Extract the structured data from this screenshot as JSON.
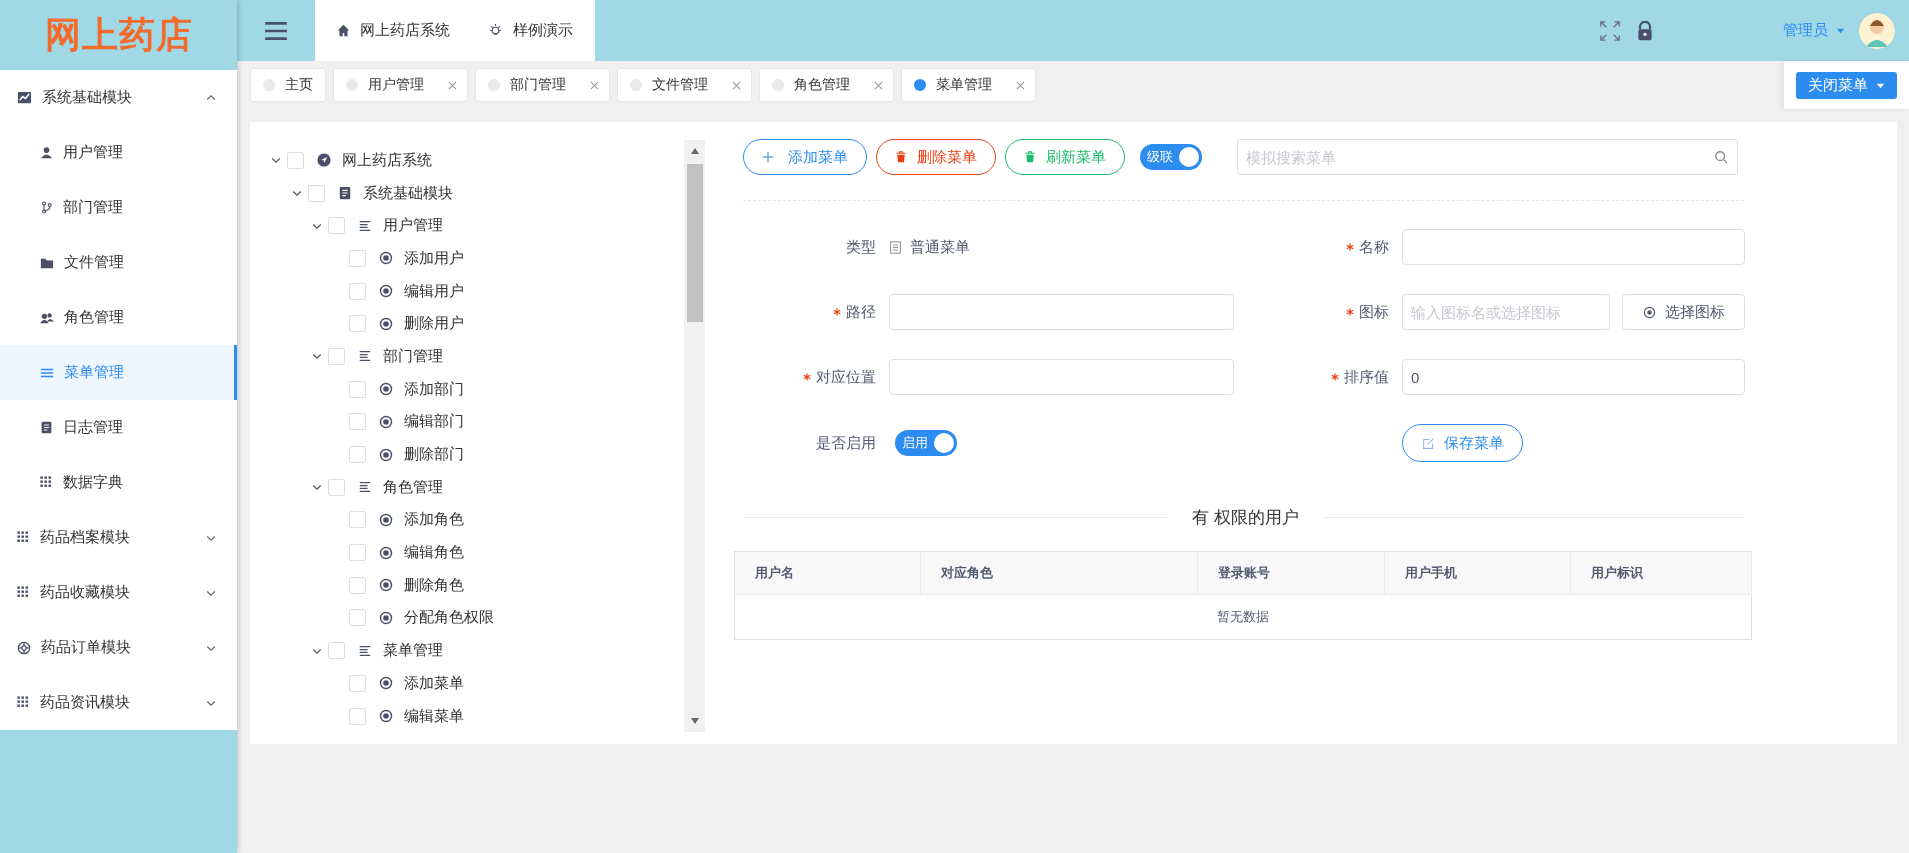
{
  "logo": "网上药店",
  "header": {
    "nav": [
      {
        "label": "网上药店系统"
      },
      {
        "label": "样例演示"
      }
    ],
    "user": "管理员"
  },
  "tabs": [
    {
      "label": "主页",
      "selected": false,
      "closable": false
    },
    {
      "label": "用户管理",
      "selected": false,
      "closable": true
    },
    {
      "label": "部门管理",
      "selected": false,
      "closable": true
    },
    {
      "label": "文件管理",
      "selected": false,
      "closable": true
    },
    {
      "label": "角色管理",
      "selected": false,
      "closable": true
    },
    {
      "label": "菜单管理",
      "selected": true,
      "closable": true
    }
  ],
  "close_menu": "关闭菜单",
  "sidebar": {
    "items": [
      {
        "label": "系统基础模块",
        "selected": false,
        "expanded": true,
        "children": [
          {
            "label": "用户管理",
            "selected": false
          },
          {
            "label": "部门管理",
            "selected": false
          },
          {
            "label": "文件管理",
            "selected": false
          },
          {
            "label": "角色管理",
            "selected": false
          },
          {
            "label": "菜单管理",
            "selected": true
          },
          {
            "label": "日志管理",
            "selected": false
          },
          {
            "label": "数据字典",
            "selected": false
          }
        ]
      },
      {
        "label": "药品档案模块",
        "selected": false,
        "expanded": false
      },
      {
        "label": "药品收藏模块",
        "selected": false,
        "expanded": false
      },
      {
        "label": "药品订单模块",
        "selected": false,
        "expanded": false
      },
      {
        "label": "药品资讯模块",
        "selected": false,
        "expanded": false
      }
    ]
  },
  "tree": [
    {
      "label": "网上药店系统",
      "kind": "system",
      "checked": false,
      "expanded": true,
      "children": [
        {
          "label": "系统基础模块",
          "kind": "module",
          "checked": false,
          "expanded": true,
          "children": [
            {
              "label": "用户管理",
              "kind": "menu",
              "checked": false,
              "expanded": true,
              "children": [
                {
                  "label": "添加用户",
                  "kind": "action",
                  "checked": false
                },
                {
                  "label": "编辑用户",
                  "kind": "action",
                  "checked": false
                },
                {
                  "label": "删除用户",
                  "kind": "action",
                  "checked": false
                }
              ]
            },
            {
              "label": "部门管理",
              "kind": "menu",
              "checked": false,
              "expanded": true,
              "children": [
                {
                  "label": "添加部门",
                  "kind": "action",
                  "checked": false
                },
                {
                  "label": "编辑部门",
                  "kind": "action",
                  "checked": false
                },
                {
                  "label": "删除部门",
                  "kind": "action",
                  "checked": false
                }
              ]
            },
            {
              "label": "角色管理",
              "kind": "menu",
              "checked": false,
              "expanded": true,
              "children": [
                {
                  "label": "添加角色",
                  "kind": "action",
                  "checked": false
                },
                {
                  "label": "编辑角色",
                  "kind": "action",
                  "checked": false
                },
                {
                  "label": "删除角色",
                  "kind": "action",
                  "checked": false
                },
                {
                  "label": "分配角色权限",
                  "kind": "action",
                  "checked": false
                }
              ]
            },
            {
              "label": "菜单管理",
              "kind": "menu",
              "checked": false,
              "expanded": true,
              "children": [
                {
                  "label": "添加菜单",
                  "kind": "action",
                  "checked": false
                },
                {
                  "label": "编辑菜单",
                  "kind": "action",
                  "checked": false
                }
              ]
            }
          ]
        }
      ]
    }
  ],
  "toolbar": {
    "buttons": [
      {
        "label": "添加菜单",
        "kind": "add"
      },
      {
        "label": "删除菜单",
        "kind": "delete"
      },
      {
        "label": "刷新菜单",
        "kind": "refresh"
      }
    ],
    "cascade": {
      "label": "级联",
      "on": true
    },
    "search": {
      "placeholder": "模拟搜索菜单"
    }
  },
  "form": {
    "rows": [
      [
        {
          "kind": "static",
          "label": "类型",
          "required": false,
          "value": "普通菜单"
        },
        {
          "kind": "input",
          "label": "名称",
          "required": true
        }
      ],
      [
        {
          "kind": "input",
          "label": "路径",
          "required": true
        },
        {
          "kind": "icon-input",
          "label": "图标",
          "required": true,
          "placeholder": "输入图标名或选择图标",
          "button": "选择图标"
        }
      ],
      [
        {
          "kind": "input",
          "label": "对应位置",
          "required": true
        },
        {
          "kind": "input",
          "label": "排序值",
          "required": true,
          "value": "0"
        }
      ],
      [
        {
          "kind": "switch",
          "label": "是否启用",
          "required": false,
          "switch_label": "启用",
          "on": true
        },
        {
          "kind": "button",
          "label": "保存菜单"
        }
      ]
    ]
  },
  "users_section": {
    "title": "有 权限的用户",
    "columns": [
      "用户名",
      "对应角色",
      "登录账号",
      "用户手机",
      "用户标识"
    ],
    "empty_text": "暂无数据"
  }
}
